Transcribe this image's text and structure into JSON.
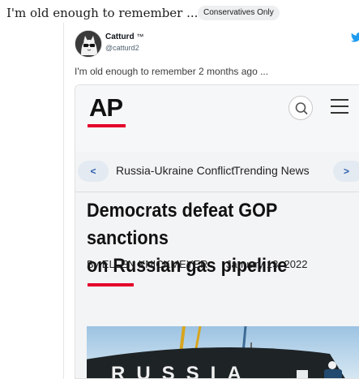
{
  "post": {
    "title": "I'm old enough to remember ...",
    "flair": "Conservatives Only"
  },
  "tweet": {
    "author_name": "Catturd",
    "author_tm": "™",
    "author_handle": "@catturd2",
    "text": "I'm old enough to remember 2 months ago ..."
  },
  "article": {
    "logo": "AP",
    "nav_prev": "<",
    "nav_next": ">",
    "nav_items": [
      "Russia-Ukraine Conflict",
      "Trending News"
    ],
    "headline_line1": "Democrats defeat GOP sanctions",
    "headline_line2": "on Russian gas pipeline",
    "byline": "By ELLEN KNICKMEYER",
    "date": "January 13, 2022",
    "photo_text": "RUSSIA"
  },
  "colors": {
    "ap_red": "#e4002b",
    "nav_button_bg": "#e3eaf2",
    "twitter_blue": "#1d9bf0"
  }
}
